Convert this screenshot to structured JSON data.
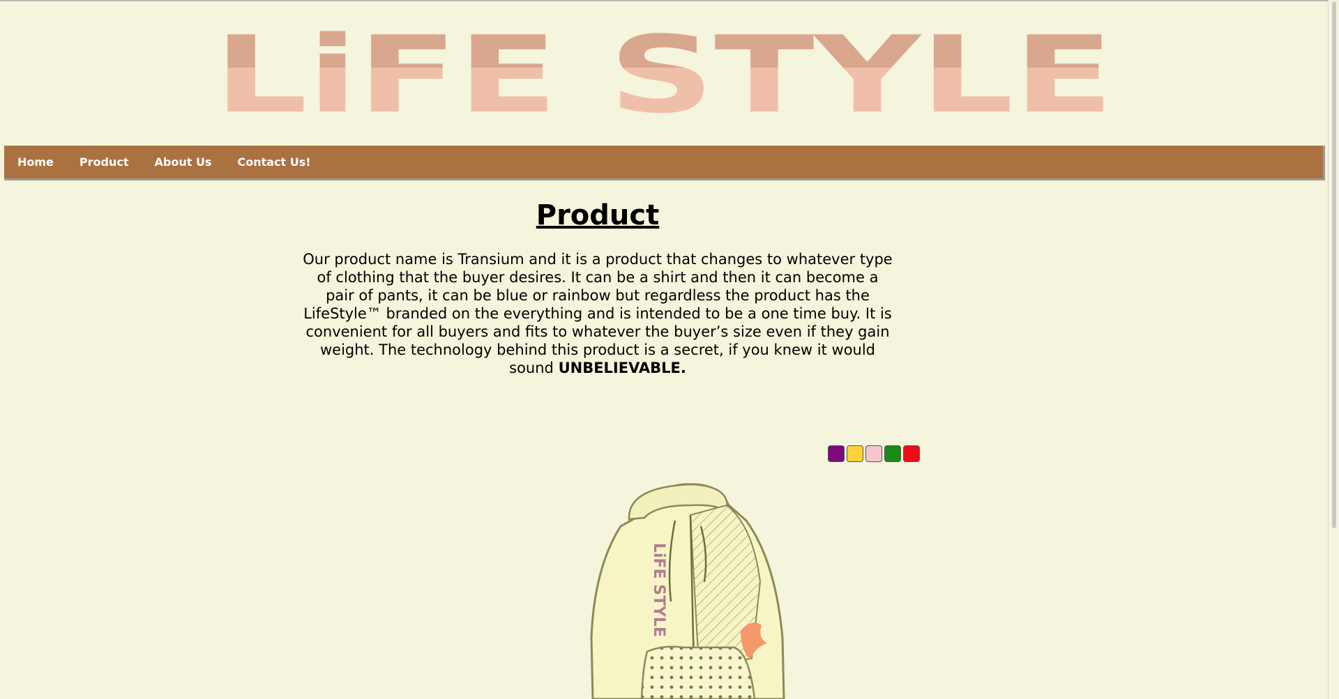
{
  "logo": {
    "text": "LiFE STYLE",
    "top_color": "#d9a68e",
    "bottom_color": "#f0bfaa"
  },
  "nav": {
    "items": [
      {
        "label": "Home"
      },
      {
        "label": "Product"
      },
      {
        "label": "About Us"
      },
      {
        "label": "Contact Us!"
      }
    ],
    "background": "#ab7241"
  },
  "page": {
    "title": "Product",
    "description": "Our product name is Transium and it is a product that changes to whatever type of clothing that the buyer desires. It can be a shirt and then it can become a pair of pants, it can be blue or rainbow but regardless the product has the LifeStyle™ branded on the everything and is intended to be a one time buy. It is convenient for all buyers and fits to whatever the buyer’s size even if they gain weight. The technology behind this product is a secret, if you knew it would sound",
    "emphasis": "UNBELIEVABLE."
  },
  "swatches": [
    {
      "color": "#7e0a7e"
    },
    {
      "color": "#ffd23a"
    },
    {
      "color": "#f6c6cf"
    },
    {
      "color": "#1a8a1a"
    },
    {
      "color": "#ee0c16"
    }
  ],
  "product_image": {
    "icon": "hoodie-image",
    "print_text": "LiFE STYLE"
  }
}
